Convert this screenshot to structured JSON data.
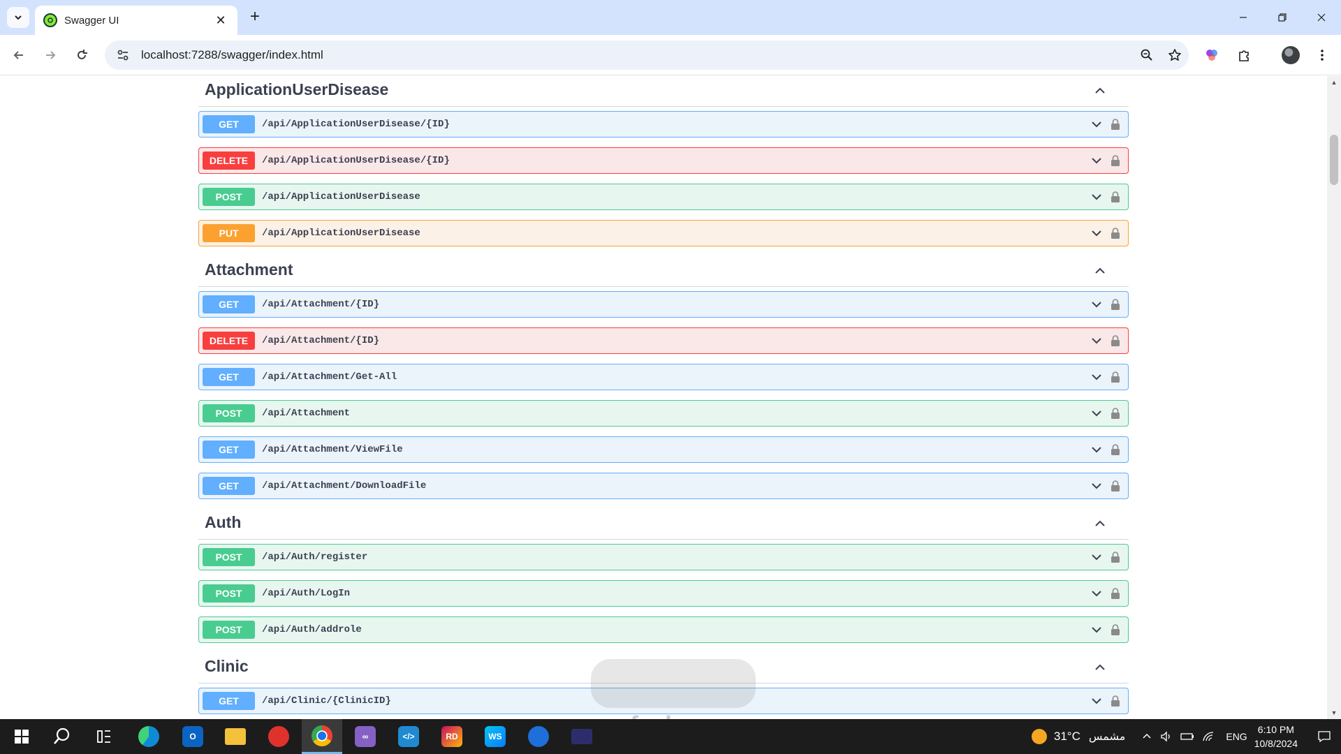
{
  "browser": {
    "tab_title": "Swagger UI",
    "tab_close": "✕",
    "new_tab": "+",
    "url": "localhost:7288/swagger/index.html"
  },
  "swagger": {
    "sections": [
      {
        "title": "ApplicationUserDisease",
        "operations": [
          {
            "method": "GET",
            "path": "/api/ApplicationUserDisease/{ID}"
          },
          {
            "method": "DELETE",
            "path": "/api/ApplicationUserDisease/{ID}"
          },
          {
            "method": "POST",
            "path": "/api/ApplicationUserDisease"
          },
          {
            "method": "PUT",
            "path": "/api/ApplicationUserDisease"
          }
        ]
      },
      {
        "title": "Attachment",
        "operations": [
          {
            "method": "GET",
            "path": "/api/Attachment/{ID}"
          },
          {
            "method": "DELETE",
            "path": "/api/Attachment/{ID}"
          },
          {
            "method": "GET",
            "path": "/api/Attachment/Get-All"
          },
          {
            "method": "POST",
            "path": "/api/Attachment"
          },
          {
            "method": "GET",
            "path": "/api/Attachment/ViewFile"
          },
          {
            "method": "GET",
            "path": "/api/Attachment/DownloadFile"
          }
        ]
      },
      {
        "title": "Auth",
        "operations": [
          {
            "method": "POST",
            "path": "/api/Auth/register"
          },
          {
            "method": "POST",
            "path": "/api/Auth/LogIn"
          },
          {
            "method": "POST",
            "path": "/api/Auth/addrole"
          }
        ]
      },
      {
        "title": "Clinic",
        "operations": [
          {
            "method": "GET",
            "path": "/api/Clinic/{ClinicID}"
          }
        ]
      }
    ]
  },
  "watermark": {
    "text": "nafezly.com"
  },
  "taskbar": {
    "apps": [
      {
        "name": "search",
        "label": ""
      },
      {
        "name": "task-view",
        "label": ""
      },
      {
        "name": "edge",
        "label": ""
      },
      {
        "name": "outlook",
        "label": ""
      },
      {
        "name": "file-explorer",
        "label": ""
      },
      {
        "name": "anydesk",
        "label": ""
      },
      {
        "name": "chrome",
        "label": ""
      },
      {
        "name": "visual-studio",
        "label": ""
      },
      {
        "name": "vscode",
        "label": ""
      },
      {
        "name": "rider",
        "label": "RD"
      },
      {
        "name": "webstorm",
        "label": "WS"
      },
      {
        "name": "app",
        "label": ""
      },
      {
        "name": "terminal",
        "label": ""
      }
    ],
    "weather": "31°C",
    "weather_desc": "مشمس",
    "language": "ENG",
    "time": "6:10 PM",
    "date": "10/8/2024"
  },
  "colors": {
    "get": "#61affe",
    "delete": "#f93e3e",
    "post": "#49cc90",
    "put": "#fca130"
  }
}
